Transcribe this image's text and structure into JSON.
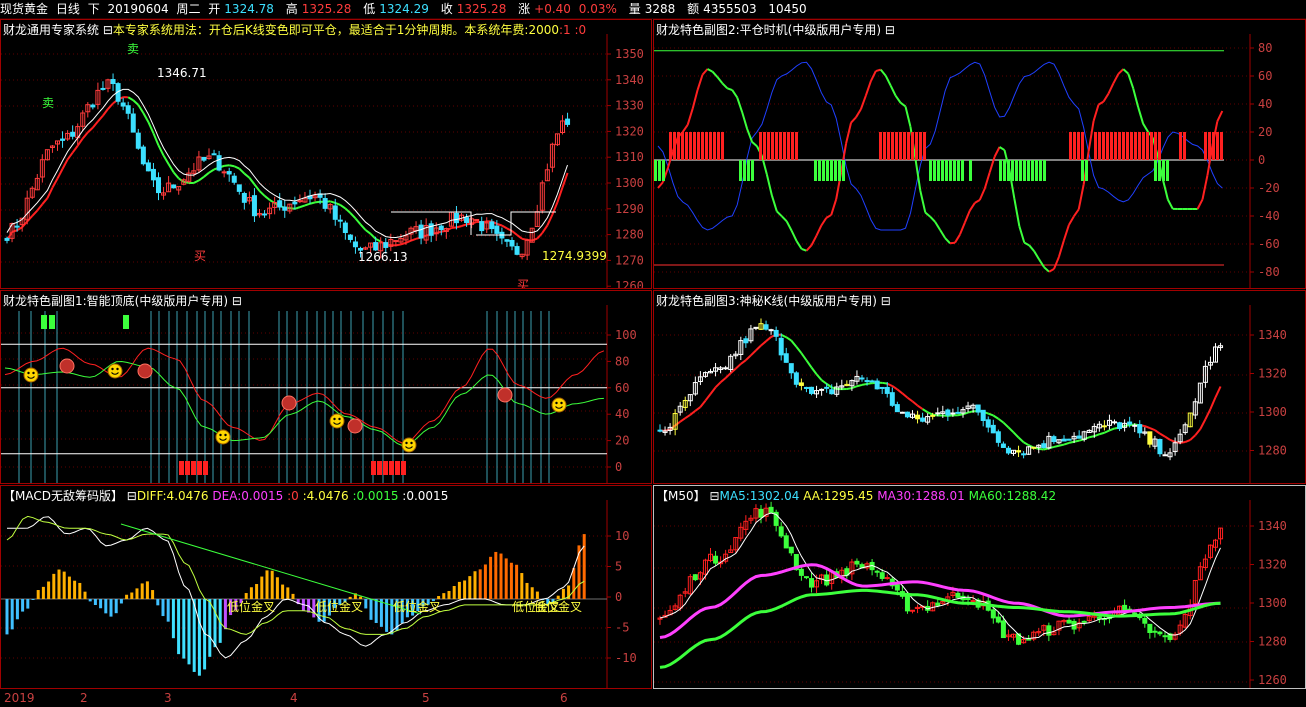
{
  "header": {
    "symbol": "现货黄金",
    "period": "日线",
    "nav": "下",
    "date": "20190604",
    "weekday": "周二",
    "open_label": "开",
    "open": "1324.78",
    "high_label": "高",
    "high": "1325.28",
    "low_label": "低",
    "low": "1324.29",
    "close_label": "收",
    "close": "1325.28",
    "chg_label": "涨",
    "chg": "+0.40",
    "pct": "0.03%",
    "vol_label": "量",
    "vol": "3288",
    "amt_label": "额",
    "amt": "4355503",
    "extra": "10450"
  },
  "panels": {
    "main": {
      "title": "财龙通用专家系统",
      "desc": "本专家系统用法：开仓后K线变色即可平仓，最适合于1分钟周期。本系统年费:2000",
      "p1": ":1",
      "p2": ":0",
      "annot_high": "1346.71",
      "annot_low": "1266.13",
      "annot_last": "1274.9399",
      "sell": "卖",
      "buy": "买",
      "yticks": [
        "1350",
        "1340",
        "1330",
        "1320",
        "1310",
        "1300",
        "1290",
        "1280",
        "1270",
        "1260"
      ]
    },
    "sub1": {
      "title": "财龙特色副图1:智能顶底(中级版用户专用)",
      "yticks": [
        "100",
        "80",
        "60",
        "40",
        "20",
        "0"
      ]
    },
    "macd": {
      "title": "【MACD无敌筹码版】",
      "diff_label": "DIFF:4.0476",
      "dea_label": "DEA:0.0015",
      "v1": ":0",
      "v2": ":4.0476",
      "v3": ":0.0015",
      "v4": ":0.0015",
      "cross_label": "低位金叉",
      "yticks": [
        "10",
        "5",
        "0",
        "-5",
        "-10"
      ]
    },
    "sub2": {
      "title": "财龙特色副图2:平仓时机(中级版用户专用)",
      "yticks": [
        "80",
        "60",
        "40",
        "20",
        "0",
        "-20",
        "-40",
        "-60",
        "-80"
      ]
    },
    "sub3": {
      "title": "财龙特色副图3:神秘K线(中级版用户专用)",
      "yticks": [
        "1340",
        "1320",
        "1300",
        "1280"
      ]
    },
    "ma": {
      "title": "【M50】",
      "ma5": "MA5:1302.04",
      "aa": "AA:1295.45",
      "ma30": "MA30:1288.01",
      "ma60": "MA60:1288.42",
      "yticks": [
        "1340",
        "1320",
        "1300",
        "1280",
        "1260"
      ]
    }
  },
  "xaxis": {
    "labels": [
      "2019",
      "2",
      "3",
      "4",
      "5",
      "6"
    ]
  },
  "colors": {
    "up": "#ff3c3c",
    "down": "#3ce0ff",
    "frame": "#a00000",
    "yellow": "#ffff40",
    "green": "#3cff3c",
    "magenta": "#ff40ff"
  },
  "chart_data": [
    {
      "type": "line",
      "name": "main-price",
      "x": [
        "2019",
        "2",
        "3",
        "4",
        "5",
        "6"
      ],
      "series": [
        {
          "values": [
            1282,
            1316,
            1338,
            1298,
            1310,
            1290,
            1296,
            1275,
            1282,
            1288,
            1275,
            1325
          ]
        }
      ],
      "ylim": [
        1260,
        1355
      ]
    },
    {
      "type": "bar",
      "name": "macd",
      "ylim": [
        -12,
        12
      ]
    }
  ]
}
